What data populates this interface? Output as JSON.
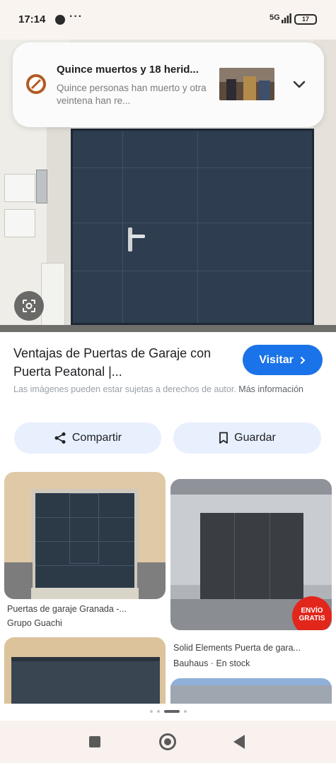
{
  "status_bar": {
    "time": "17:14",
    "more": "···",
    "network": "5G",
    "battery": "17"
  },
  "notification": {
    "title": "Quince muertos y 18 herid...",
    "body": "Quince personas han muerto y otra veintena han re...",
    "app_icon": "news-app-icon",
    "expand_icon": "chevron-down-icon"
  },
  "result": {
    "title": "Ventajas de Puertas de Garaje con Puerta Peatonal |...",
    "visit_label": "Visitar",
    "copyright_text": "Las imágenes pueden estar sujetas a derechos de autor.",
    "more_info_label": "Más información"
  },
  "actions": {
    "share_label": "Compartir",
    "save_label": "Guardar"
  },
  "related": [
    {
      "caption": "Puertas de garaje Granada -...",
      "source": "Grupo Guachi"
    },
    {
      "caption": "Solid Elements Puerta de gara...",
      "source": "Bauhaus · En stock",
      "badge": "ENVÍO GRATIS"
    }
  ],
  "colors": {
    "visit_button": "#1a73e8",
    "action_button_bg": "#e8f0fe",
    "badge_red": "#e2261c",
    "door_navy": "#2e3d4f"
  }
}
